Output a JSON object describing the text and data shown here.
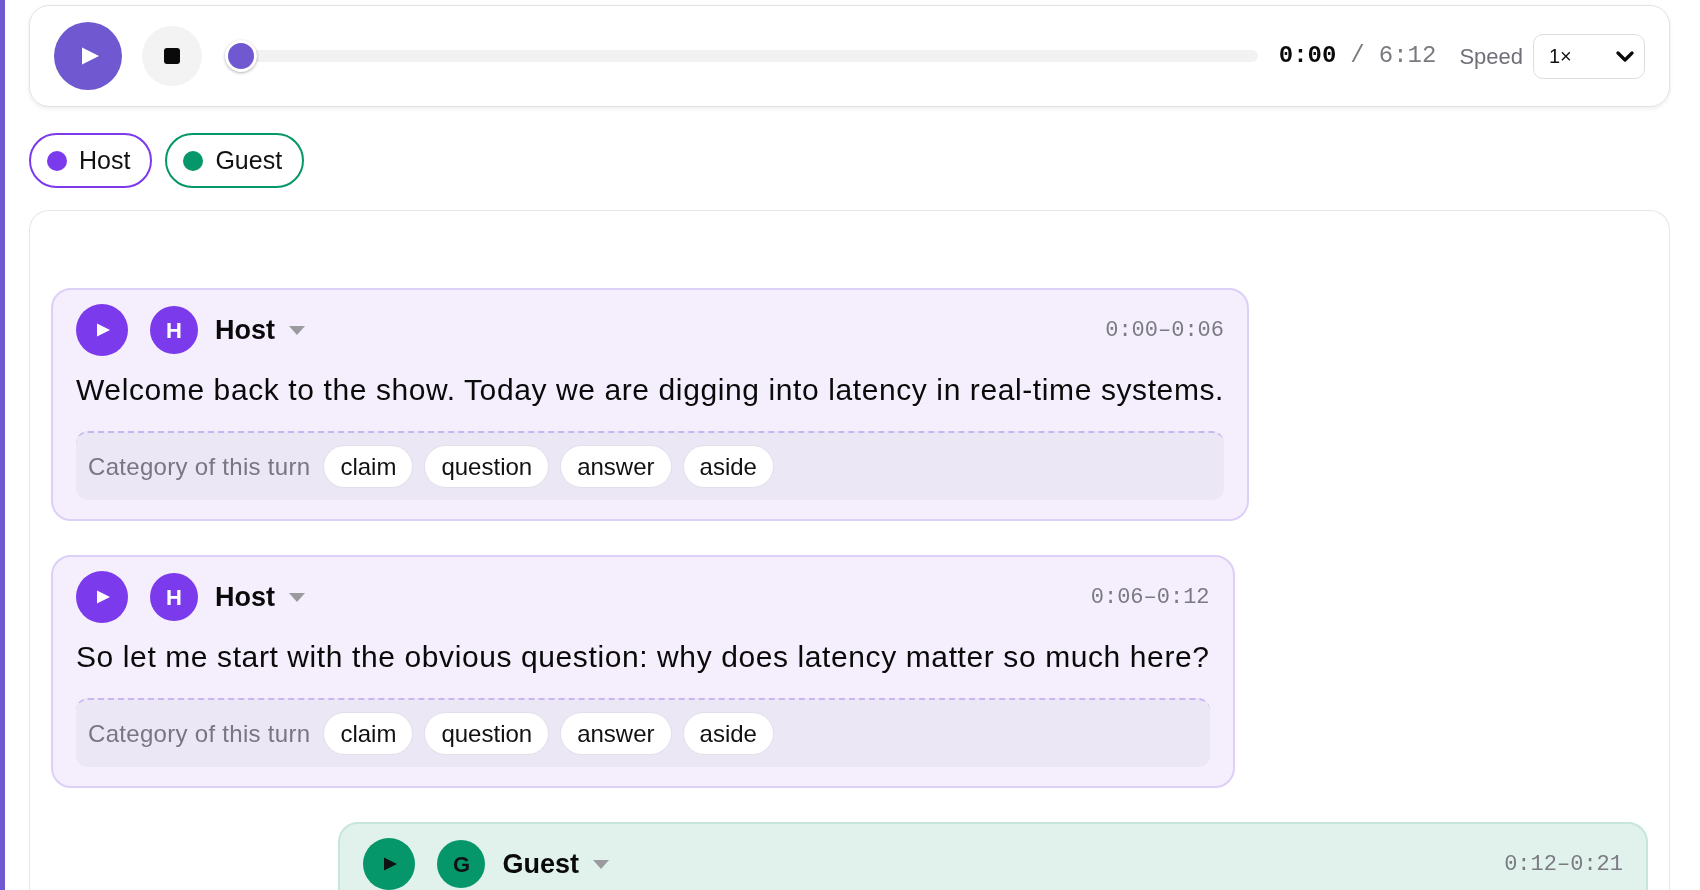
{
  "player": {
    "level": 0,
    "current_time": "0:00",
    "time_separator": "/",
    "total_time": "6:12",
    "speed_label": "Speed",
    "speed": "1×"
  },
  "speakers": [
    {
      "label": "Host",
      "color": "#7c3aed"
    },
    {
      "label": "Guest",
      "color": "#059669"
    }
  ],
  "turns": [
    {
      "kind": "host",
      "avatar": "H",
      "speaker": "Host",
      "time": "0:00–0:06",
      "text": "Welcome back to the show. Today we are digging into latency in real-time systems.",
      "category_label": "Category of this turn",
      "categories": [
        {
          "label": "claim",
          "selected": false
        },
        {
          "label": "question",
          "selected": false
        },
        {
          "label": "answer",
          "selected": false
        },
        {
          "label": "aside",
          "selected": false
        }
      ]
    },
    {
      "kind": "host",
      "avatar": "H",
      "speaker": "Host",
      "time": "0:06–0:12",
      "text": "So let me start with the obvious question: why does latency matter so much here?",
      "category_label": "Category of this turn",
      "categories": [
        {
          "label": "claim",
          "selected": false
        },
        {
          "label": "question",
          "selected": false
        },
        {
          "label": "answer",
          "selected": false
        },
        {
          "label": "aside",
          "selected": false
        }
      ]
    },
    {
      "kind": "guest",
      "avatar": "G",
      "speaker": "Guest",
      "time": "0:12–0:21"
    }
  ]
}
